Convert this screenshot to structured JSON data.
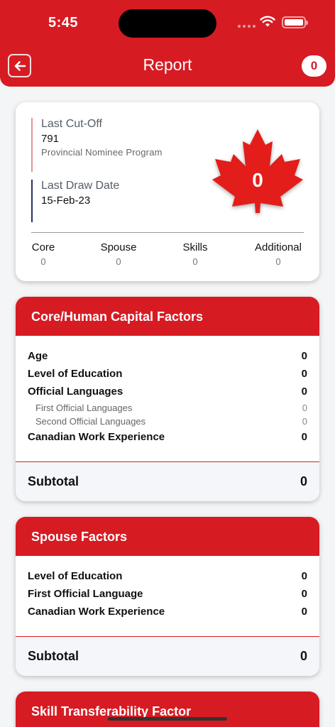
{
  "status_bar": {
    "time": "5:45"
  },
  "header": {
    "title": "Report",
    "score": "0"
  },
  "summary": {
    "last_cutoff_label": "Last Cut-Off",
    "last_cutoff_value": "791",
    "last_cutoff_program": "Provincial Nominee Program",
    "last_draw_label": "Last Draw Date",
    "last_draw_value": "15-Feb-23",
    "total_score": "0",
    "breakdown": [
      {
        "label": "Core",
        "value": "0"
      },
      {
        "label": "Spouse",
        "value": "0"
      },
      {
        "label": "Skills",
        "value": "0"
      },
      {
        "label": "Additional",
        "value": "0"
      }
    ]
  },
  "core_section": {
    "title": "Core/Human Capital Factors",
    "rows": [
      {
        "label": "Age",
        "value": "0"
      },
      {
        "label": "Level of Education",
        "value": "0"
      },
      {
        "label": "Official Languages",
        "value": "0"
      },
      {
        "label": "First Official Languages",
        "value": "0"
      },
      {
        "label": "Second Official Languages",
        "value": "0"
      },
      {
        "label": "Canadian Work Experience",
        "value": "0"
      }
    ],
    "subtotal_label": "Subtotal",
    "subtotal_value": "0"
  },
  "spouse_section": {
    "title": "Spouse Factors",
    "rows": [
      {
        "label": "Level of Education",
        "value": "0"
      },
      {
        "label": "First Official Language",
        "value": "0"
      },
      {
        "label": "Canadian Work Experience",
        "value": "0"
      }
    ],
    "subtotal_label": "Subtotal",
    "subtotal_value": "0"
  },
  "skill_section": {
    "title": "Skill Transferability Factor"
  },
  "colors": {
    "brand_red": "#d71b23",
    "navy": "#2b3160"
  }
}
